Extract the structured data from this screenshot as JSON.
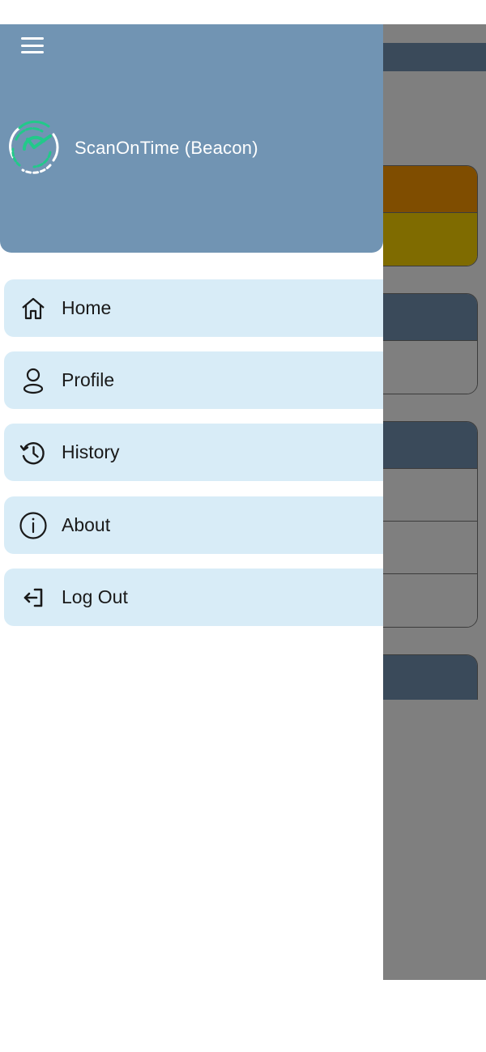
{
  "app": {
    "title": "ScanOnTime (Beacon)",
    "logo_icon": "clock-scan-logo",
    "header_color": "#7194b3",
    "accent_color": "#22c98a"
  },
  "drawer": {
    "items": [
      {
        "label": "Home",
        "icon": "home-icon"
      },
      {
        "label": "Profile",
        "icon": "user-icon"
      },
      {
        "label": "History",
        "icon": "history-icon"
      },
      {
        "label": "About",
        "icon": "info-icon"
      },
      {
        "label": "Log Out",
        "icon": "logout-icon"
      }
    ],
    "item_background": "#d8ecf7"
  },
  "background_colors": {
    "orange": "#7f4d00",
    "olive": "#7f6b00",
    "dark_slate": "#3a4a5a",
    "scrim_grey": "#7f7f7f"
  }
}
